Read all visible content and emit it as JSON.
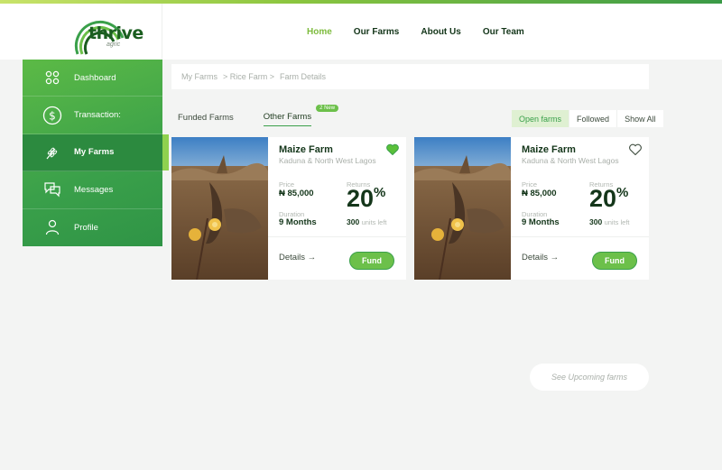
{
  "brand": {
    "name": "thrive",
    "tagline": "agric"
  },
  "nav": [
    {
      "label": "Home",
      "active": true
    },
    {
      "label": "Our Farms",
      "active": false
    },
    {
      "label": "About Us",
      "active": false
    },
    {
      "label": "Our Team",
      "active": false
    }
  ],
  "sidebar": {
    "items": [
      {
        "label": "Dashboard",
        "icon": "dashboard-icon"
      },
      {
        "label": "Transaction:",
        "icon": "dollar-icon"
      },
      {
        "label": "My Farms",
        "icon": "wheat-icon",
        "active": true
      },
      {
        "label": "Messages",
        "icon": "messages-icon"
      },
      {
        "label": "Profile",
        "icon": "profile-icon"
      }
    ]
  },
  "breadcrumb": [
    "My Farms",
    "> Rice Farm >",
    "Farm Details"
  ],
  "tabs": [
    {
      "label": "Funded Farms",
      "active": false
    },
    {
      "label": "Other Farms",
      "active": true,
      "badge": "2 New"
    }
  ],
  "filters": [
    {
      "label": "Open farms",
      "active": true
    },
    {
      "label": "Followed",
      "active": false
    },
    {
      "label": "Show All",
      "active": false
    }
  ],
  "cards": [
    {
      "title": "Maize Farm",
      "location": "Kaduna & North West Lagos",
      "price_label": "Price",
      "price": "₦ 85,000",
      "returns_label": "Returns",
      "returns_value": "20",
      "returns_unit": "%",
      "duration_label": "Duration",
      "duration": "9 Months",
      "units_count": "300",
      "units_text": "units left",
      "details_label": "Details →",
      "fund_label": "Fund",
      "favorited": true
    },
    {
      "title": "Maize Farm",
      "location": "Kaduna & North West Lagos",
      "price_label": "Price",
      "price": "₦ 85,000",
      "returns_label": "Returns",
      "returns_value": "20",
      "returns_unit": "%",
      "duration_label": "Duration",
      "duration": "9 Months",
      "units_count": "300",
      "units_text": "units left",
      "details_label": "Details →",
      "fund_label": "Fund",
      "favorited": false
    }
  ],
  "upcoming_label": "See Upcoming farms",
  "colors": {
    "accent": "#3aa04a",
    "accent_light": "#6cc04a",
    "nav_active": "#7dbb3d",
    "dark_text": "#14361a"
  }
}
